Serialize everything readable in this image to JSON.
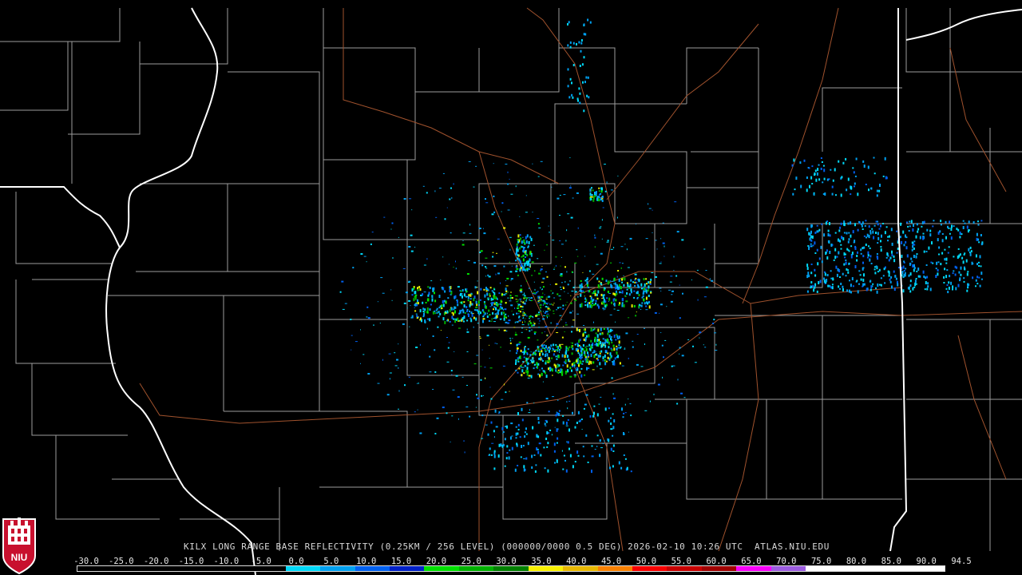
{
  "caption": "KILX LONG RANGE BASE REFLECTIVITY (0.25KM / 256 LEVEL) (000000/0000 0.5 DEG) 2026-02-10 10:26 UTC  ATLAS.NIU.EDU",
  "logo_text": "NIU",
  "colors": {
    "background": "#000000",
    "county_lines": "#a0a0a0",
    "state_lines": "#ffffff",
    "roads": "#a0522d",
    "logo_red": "#c8102e"
  },
  "scale": {
    "labels": [
      "-30.0",
      "-25.0",
      "-20.0",
      "-15.0",
      "-10.0",
      "-5.0",
      "0.0",
      "5.0",
      "10.0",
      "15.0",
      "20.0",
      "25.0",
      "30.0",
      "35.0",
      "40.0",
      "45.0",
      "50.0",
      "55.0",
      "60.0",
      "65.0",
      "70.0",
      "75.0",
      "80.0",
      "85.0",
      "90.0",
      "94.5"
    ],
    "colors": [
      "#000000",
      "#000000",
      "#000000",
      "#000000",
      "#000000",
      "#000000",
      "#00d8f8",
      "#00a0f0",
      "#0060f0",
      "#0020c8",
      "#00e000",
      "#00b000",
      "#008000",
      "#f8f000",
      "#e8b800",
      "#f88000",
      "#f80000",
      "#c80000",
      "#a00000",
      "#f800f8",
      "#9c5ce0",
      "#ffffff",
      "#ffffff",
      "#ffffff",
      "#ffffff"
    ]
  }
}
